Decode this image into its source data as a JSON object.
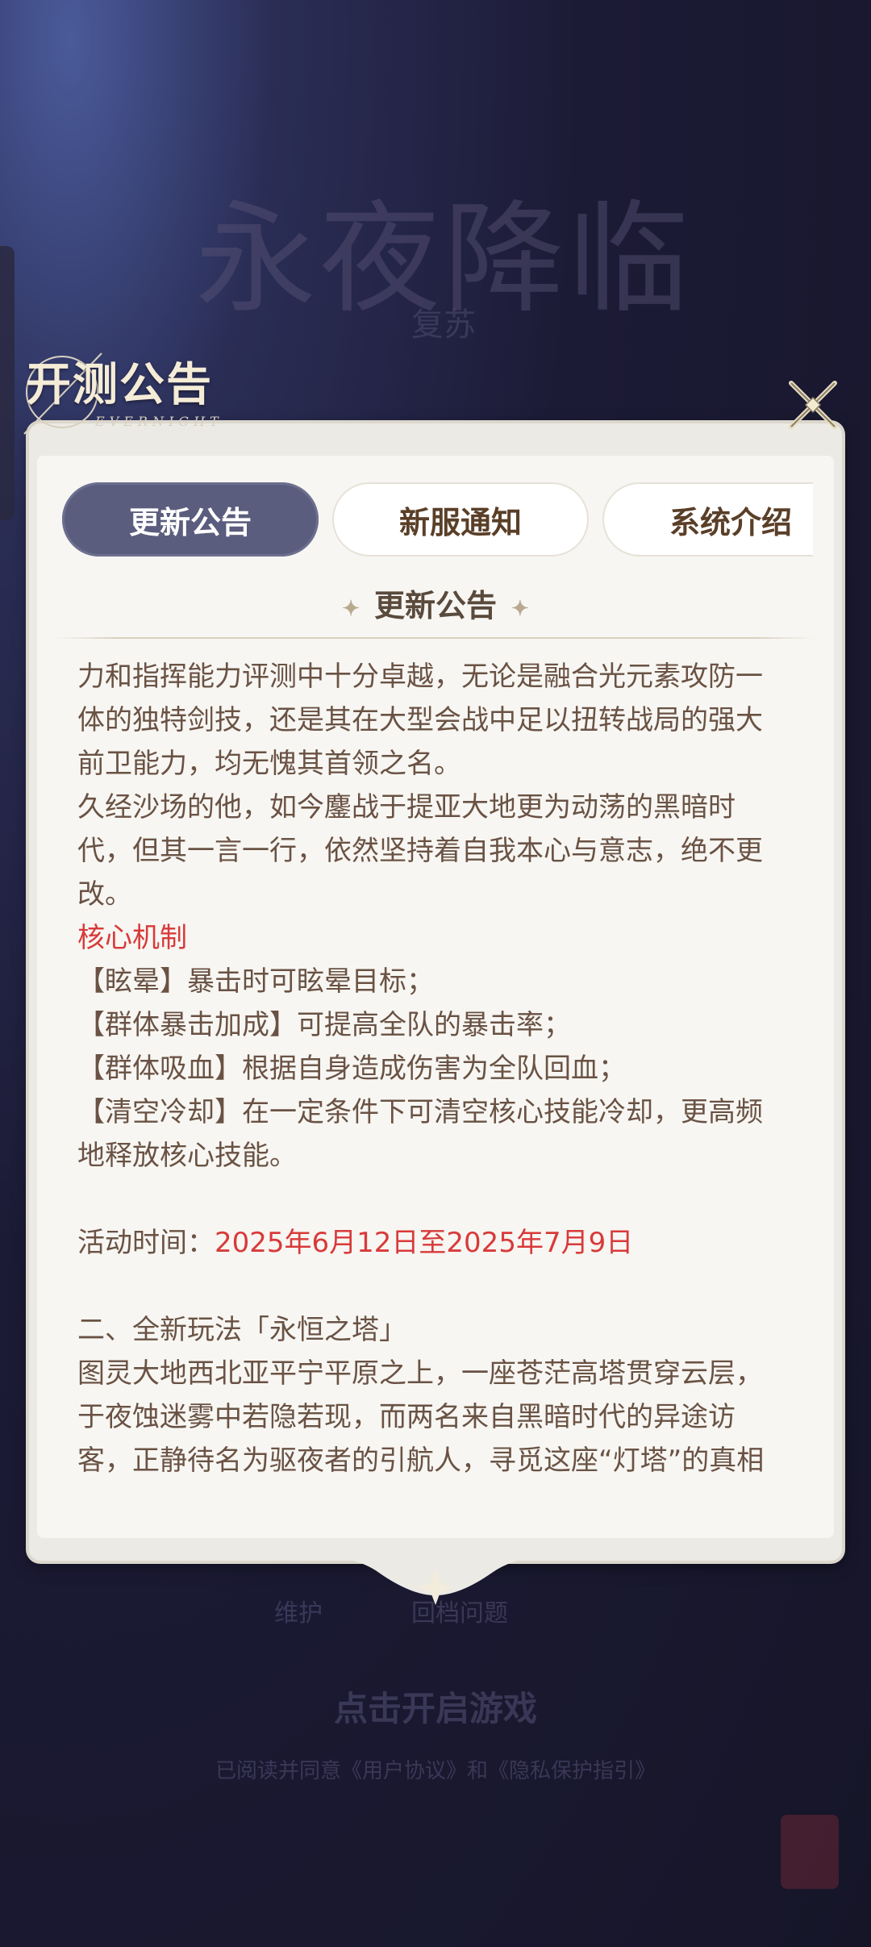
{
  "background": {
    "logo_text": "永夜降临",
    "logo_sub": "复苏",
    "footer_items": [
      "维护",
      "回档问题",
      ""
    ],
    "footer_cta": "点击开启游戏",
    "footer_terms": "已阅读并同意《用户协议》和《隐私保护指引》"
  },
  "modal": {
    "title": "开测公告",
    "subtitle": "EVERNIGHT",
    "close_icon": "close-x-icon",
    "tabs": [
      {
        "label": "更新公告",
        "active": true
      },
      {
        "label": "新服通知",
        "active": false
      },
      {
        "label": "系统介绍",
        "active": false
      }
    ],
    "section_title": "更新公告",
    "content": {
      "p1": "力和指挥能力评测中十分卓越，无论是融合光元素攻防一体的独特剑技，还是其在大型会战中足以扭转战局的强大前卫能力，均无愧其首领之名。",
      "p2": "久经沙场的他，如今鏖战于提亚大地更为动荡的黑暗时代，但其一言一行，依然坚持着自我本心与意志，绝不更改。",
      "core_heading": "核心机制",
      "m1": "【眩晕】暴击时可眩晕目标；",
      "m2": "【群体暴击加成】可提高全队的暴击率；",
      "m3": "【群体吸血】根据自身造成伤害为全队回血；",
      "m4": "【清空冷却】在一定条件下可清空核心技能冷却，更高频地释放核心技能。",
      "activity_label": "活动时间：",
      "activity_value": "2025年6月12日至2025年7月9日",
      "section2": "二、全新玩法「永恒之塔」",
      "p3": "图灵大地西北亚平宁平原之上，一座苍茫高塔贯穿云层，于夜蚀迷雾中若隐若现，而两名来自黑暗时代的异途访客，正静待名为驱夜者的引航人，寻觅这座“灯塔”的真相"
    }
  },
  "colors": {
    "accent_tab": "#5b5d7e",
    "text_brown": "#6a5244",
    "highlight_red": "#d83a3a"
  }
}
